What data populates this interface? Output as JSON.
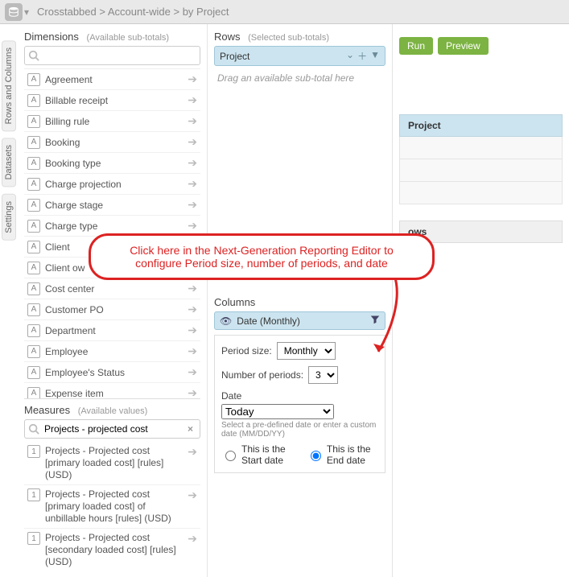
{
  "breadcrumb": "Crosstabbed  >  Account-wide  >  by Project",
  "tabs": {
    "rows_cols": "Rows and Columns",
    "datasets": "Datasets",
    "settings": "Settings"
  },
  "dimensions": {
    "title": "Dimensions",
    "subtitle": "(Available sub-totals)",
    "search_placeholder": "",
    "items": [
      "Agreement",
      "Billable receipt",
      "Billing rule",
      "Booking",
      "Booking type",
      "Charge projection",
      "Charge stage",
      "Charge type",
      "Client",
      "Client ow",
      "Cost center",
      "Customer PO",
      "Department",
      "Employee",
      "Employee's Status",
      "Expense item"
    ]
  },
  "measures": {
    "title": "Measures",
    "subtitle": "(Available values)",
    "search_value": "Projects - projected cost",
    "items": [
      "Projects - Projected cost [primary loaded cost] [rules] (USD)",
      "Projects - Projected cost [primary loaded cost] of unbillable hours [rules] (USD)",
      "Projects - Projected cost [secondary loaded cost] [rules] (USD)"
    ]
  },
  "rows": {
    "title": "Rows",
    "subtitle": "(Selected sub-totals)",
    "chip": "Project",
    "hint": "Drag an available sub-total here"
  },
  "columns": {
    "title": "Columns",
    "chip": "Date (Monthly)",
    "period_label": "Period size:",
    "period_value": "Monthly",
    "nperiods_label": "Number of periods:",
    "nperiods_value": "3",
    "date_label": "Date",
    "date_value": "Today",
    "date_help": "Select a pre-defined date or enter a custom date (MM/DD/YY)",
    "radio_start": "This is the Start date",
    "radio_end": "This is the End date"
  },
  "buttons": {
    "run": "Run",
    "preview": "Preview"
  },
  "preview": {
    "header": "Project",
    "subhead": "ows"
  },
  "callout": "Click here in the Next-Generation Reporting Editor to configure Period size, number of periods, and date"
}
